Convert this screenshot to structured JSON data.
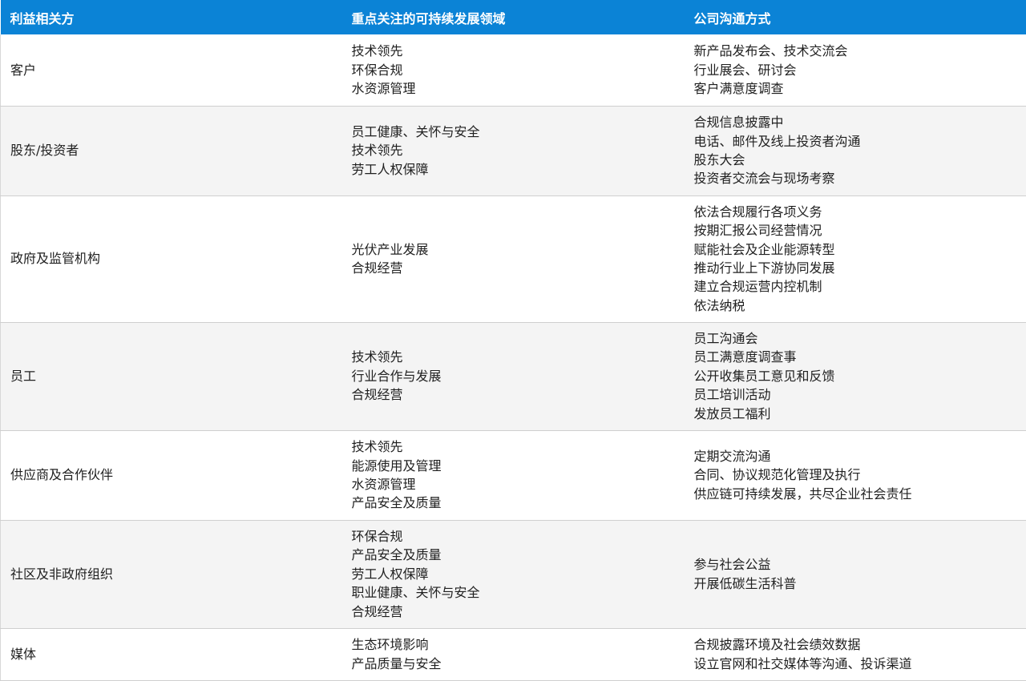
{
  "table": {
    "headers": [
      "利益相关方",
      "重点关注的可持续发展领域",
      "公司沟通方式"
    ],
    "rows": [
      {
        "stakeholder": "客户",
        "focus": [
          "技术领先",
          "环保合规",
          "水资源管理"
        ],
        "communication": [
          "新产品发布会、技术交流会",
          "行业展会、研讨会",
          "客户满意度调查"
        ]
      },
      {
        "stakeholder": "股东/投资者",
        "focus": [
          "员工健康、关怀与安全",
          "技术领先",
          "劳工人权保障"
        ],
        "communication": [
          "合规信息披露中",
          "电话、邮件及线上投资者沟通",
          "股东大会",
          "投资者交流会与现场考察"
        ]
      },
      {
        "stakeholder": "政府及监管机构",
        "focus": [
          "光伏产业发展",
          "合规经营"
        ],
        "communication": [
          "依法合规履行各项义务",
          "按期汇报公司经营情况",
          "赋能社会及企业能源转型",
          "推动行业上下游协同发展",
          "建立合规运营内控机制",
          "依法纳税"
        ]
      },
      {
        "stakeholder": "员工",
        "focus": [
          "技术领先",
          "行业合作与发展",
          "合规经营"
        ],
        "communication": [
          "员工沟通会",
          "员工满意度调查事",
          "公开收集员工意见和反馈",
          "员工培训活动",
          "发放员工福利"
        ]
      },
      {
        "stakeholder": "供应商及合作伙伴",
        "focus": [
          "技术领先",
          "能源使用及管理",
          "水资源管理",
          "产品安全及质量"
        ],
        "communication": [
          "定期交流沟通",
          "合同、协议规范化管理及执行",
          "供应链可持续发展，共尽企业社会责任"
        ]
      },
      {
        "stakeholder": "社区及非政府组织",
        "focus": [
          "环保合规",
          "产品安全及质量",
          "劳工人权保障",
          "职业健康、关怀与安全",
          "合规经营"
        ],
        "communication": [
          "参与社会公益",
          "开展低碳生活科普"
        ]
      },
      {
        "stakeholder": "媒体",
        "focus": [
          "生态环境影响",
          "产品质量与安全"
        ],
        "communication": [
          "合规披露环境及社会绩效数据",
          "设立官网和社交媒体等沟通、投诉渠道"
        ]
      }
    ]
  },
  "colors": {
    "header_bg": "#0b83d6",
    "header_text": "#ffffff",
    "row_alt_bg": "#f4f4f4",
    "border": "#cfcfcf"
  }
}
